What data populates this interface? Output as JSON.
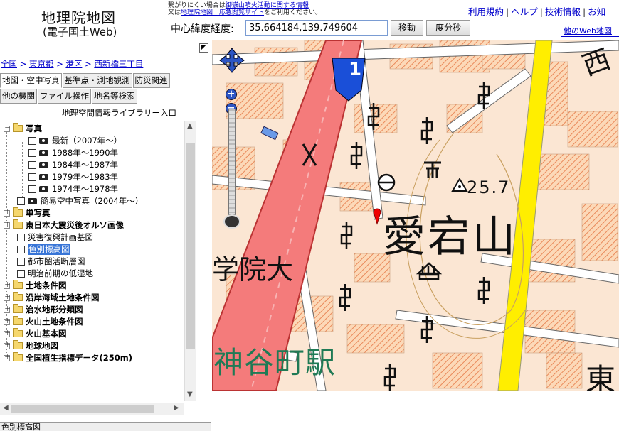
{
  "header": {
    "title": "地理院地図",
    "subtitle": "(電子国土Web)",
    "notice_line1_prefix": "繋がりにくい場合は",
    "notice_line1_link": "御嶽山噴火活動に関する情報",
    "notice_line2_prefix": "又は",
    "notice_line2_link": "地理院地図　応急閲覧サイト",
    "notice_line2_suffix": "をご利用ください。",
    "coord_label": "中心緯度経度:",
    "coord_value": "35.664184,139.749604",
    "move_button": "移動",
    "dms_button": "度分秒",
    "links": [
      "利用規約",
      "ヘルプ",
      "技術情報",
      "お知"
    ],
    "other_web": "他のWeb地図"
  },
  "sidebar": {
    "collapse_icon": "◤",
    "breadcrumb": [
      "全国",
      "東京都",
      "港区",
      "西新橋三丁目"
    ],
    "breadcrumb_sep": " > ",
    "tabs_row1": [
      "地図・空中写真",
      "基準点・測地観測",
      "防災関連"
    ],
    "tabs_row2": [
      "他の機関",
      "ファイル操作",
      "地名等検索"
    ],
    "library_link": "地理空間情報ライブラリー入口",
    "tree": [
      {
        "label": "写真",
        "kind": "folder",
        "expander": "－",
        "bold": true
      },
      {
        "label": "最新（2007年～）",
        "kind": "photo"
      },
      {
        "label": "1988年～1990年",
        "kind": "photo"
      },
      {
        "label": "1984年～1987年",
        "kind": "photo"
      },
      {
        "label": "1979年～1983年",
        "kind": "photo"
      },
      {
        "label": "1974年～1978年",
        "kind": "photo"
      },
      {
        "label": "簡易空中写真（2004年～）",
        "kind": "photo2"
      },
      {
        "label": "単写真",
        "kind": "folder",
        "expander": "＋",
        "bold": true
      },
      {
        "label": "東日本大震災後オルソ画像",
        "kind": "folder",
        "expander": "＋",
        "bold": true
      },
      {
        "label": "災害復興計画基図",
        "kind": "check"
      },
      {
        "label": "色別標高図",
        "kind": "check",
        "selected": true
      },
      {
        "label": "都市圏活断層図",
        "kind": "check"
      },
      {
        "label": "明治前期の低湿地",
        "kind": "check"
      },
      {
        "label": "土地条件図",
        "kind": "folder",
        "expander": "＋",
        "bold": true
      },
      {
        "label": "沿岸海域土地条件図",
        "kind": "folder",
        "expander": "＋",
        "bold": true
      },
      {
        "label": "治水地形分類図",
        "kind": "folder",
        "expander": "＋",
        "bold": true
      },
      {
        "label": "火山土地条件図",
        "kind": "folder",
        "expander": "＋",
        "bold": true
      },
      {
        "label": "火山基本図",
        "kind": "folder",
        "expander": "＋",
        "bold": true
      },
      {
        "label": "地球地図",
        "kind": "folder",
        "expander": "＋",
        "bold": true
      },
      {
        "label": "全国植生指標データ(250m)",
        "kind": "folder",
        "expander": "＋",
        "bold": true
      }
    ],
    "bottom_panel": "色別標高図"
  },
  "map": {
    "label_atago": "愛宕山",
    "label_gakuin": "学院大",
    "label_kamiya": "神谷町駅",
    "label_higashi": "東",
    "label_nishi": "西",
    "elevation": "25.7",
    "route_number": "1",
    "zoom_in": "+",
    "zoom_out": "−"
  }
}
